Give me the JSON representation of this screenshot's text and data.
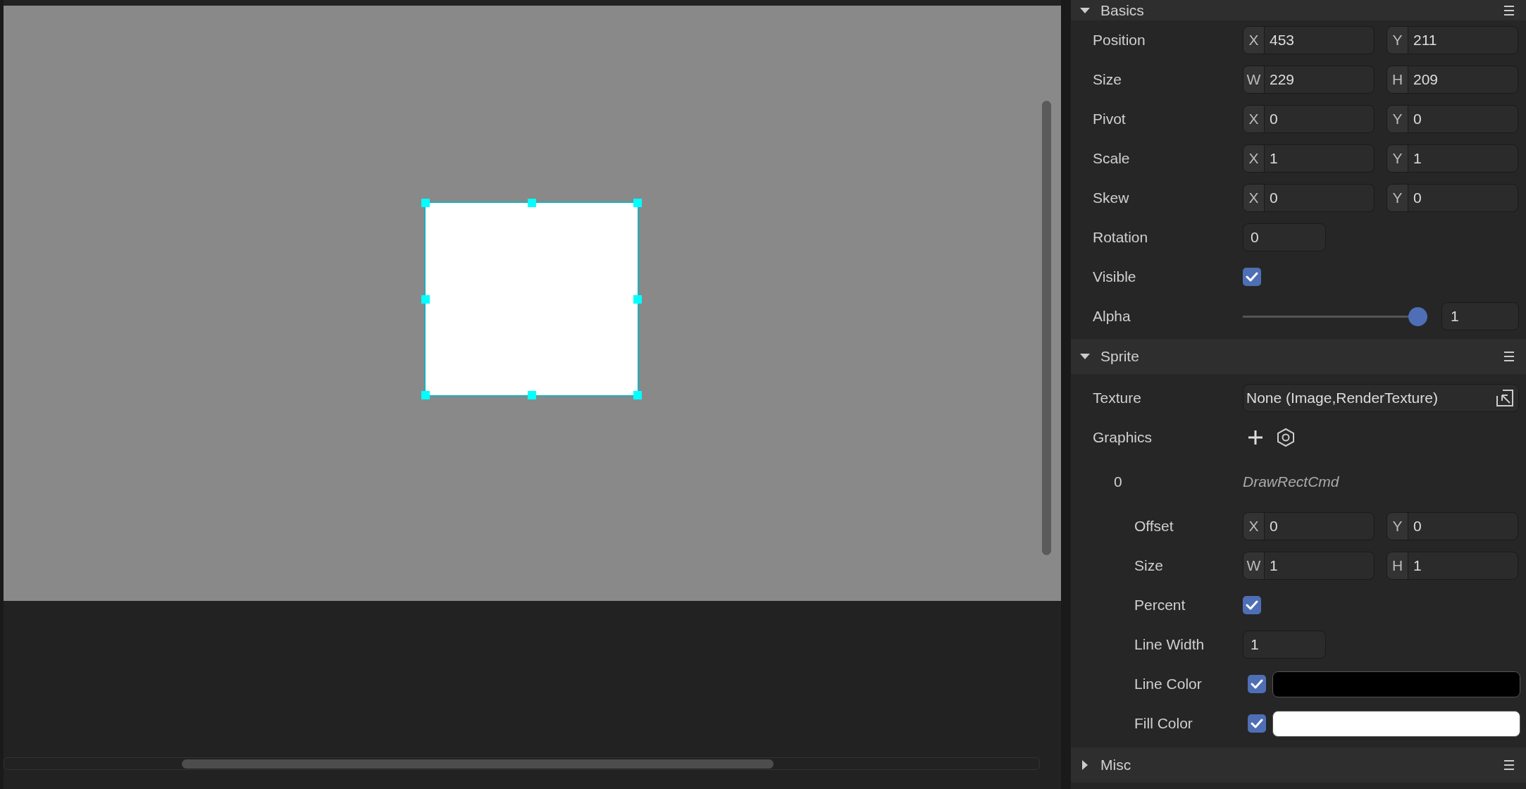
{
  "canvas": {
    "shape": {
      "selected": true
    }
  },
  "inspector": {
    "sections": [
      {
        "title": "Basics",
        "expanded": true,
        "rows": [
          {
            "kind": "pair",
            "label": "Position",
            "fields": [
              {
                "axis": "X",
                "value": "453"
              },
              {
                "axis": "Y",
                "value": "211"
              }
            ]
          },
          {
            "kind": "pair",
            "label": "Size",
            "fields": [
              {
                "axis": "W",
                "value": "229"
              },
              {
                "axis": "H",
                "value": "209"
              }
            ]
          },
          {
            "kind": "pair",
            "label": "Pivot",
            "fields": [
              {
                "axis": "X",
                "value": "0"
              },
              {
                "axis": "Y",
                "value": "0"
              }
            ]
          },
          {
            "kind": "pair",
            "label": "Scale",
            "fields": [
              {
                "axis": "X",
                "value": "1"
              },
              {
                "axis": "Y",
                "value": "1"
              }
            ]
          },
          {
            "kind": "pair",
            "label": "Skew",
            "fields": [
              {
                "axis": "X",
                "value": "0"
              },
              {
                "axis": "Y",
                "value": "0"
              }
            ]
          },
          {
            "kind": "single",
            "label": "Rotation",
            "value": "0"
          },
          {
            "kind": "checkbox",
            "label": "Visible",
            "checked": true
          },
          {
            "kind": "slider",
            "label": "Alpha",
            "level": 1,
            "value": "1"
          }
        ]
      },
      {
        "title": "Sprite",
        "expanded": true,
        "rows": [
          {
            "kind": "select",
            "label": "Texture",
            "value": "None (Image,RenderTexture)"
          },
          {
            "kind": "buttons",
            "label": "Graphics"
          },
          {
            "kind": "command",
            "label": "0",
            "value": "DrawRectCmd",
            "children": [
              {
                "kind": "pair",
                "label": "Offset",
                "fields": [
                  {
                    "axis": "X",
                    "value": "0"
                  },
                  {
                    "axis": "Y",
                    "value": "0"
                  }
                ]
              },
              {
                "kind": "pair",
                "label": "Size",
                "fields": [
                  {
                    "axis": "W",
                    "value": "1"
                  },
                  {
                    "axis": "H",
                    "value": "1"
                  }
                ]
              },
              {
                "kind": "checkbox",
                "label": "Percent",
                "checked": true
              },
              {
                "kind": "single",
                "label": "Line Width",
                "value": "1"
              },
              {
                "kind": "color",
                "label": "Line Color",
                "checked": true,
                "color": "#000000"
              },
              {
                "kind": "color",
                "label": "Fill Color",
                "checked": true,
                "color": "#ffffff"
              }
            ]
          }
        ]
      },
      {
        "title": "Misc",
        "expanded": false
      }
    ]
  }
}
